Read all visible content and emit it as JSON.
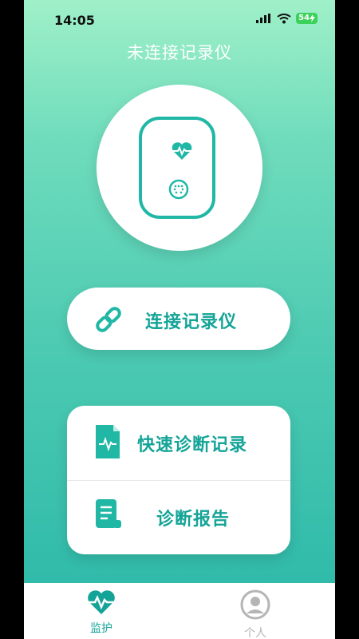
{
  "status_bar": {
    "time": "14:05",
    "battery": "54"
  },
  "header": {
    "title": "未连接记录仪"
  },
  "device": {
    "icon": "ecg-recorder-device"
  },
  "connect": {
    "label": "连接记录仪",
    "icon": "link-icon"
  },
  "menu": {
    "items": [
      {
        "label": "快速诊断记录",
        "icon": "ecg-document-icon"
      },
      {
        "label": "诊断报告",
        "icon": "report-icon"
      }
    ]
  },
  "tabbar": {
    "tabs": [
      {
        "label": "监护",
        "icon": "heartbeat-icon",
        "active": true
      },
      {
        "label": "个人",
        "icon": "profile-icon",
        "active": false
      }
    ]
  },
  "colors": {
    "accent": "#14a497",
    "gradient_top": "#9ff0c8",
    "gradient_bottom": "#2ab7a8"
  }
}
